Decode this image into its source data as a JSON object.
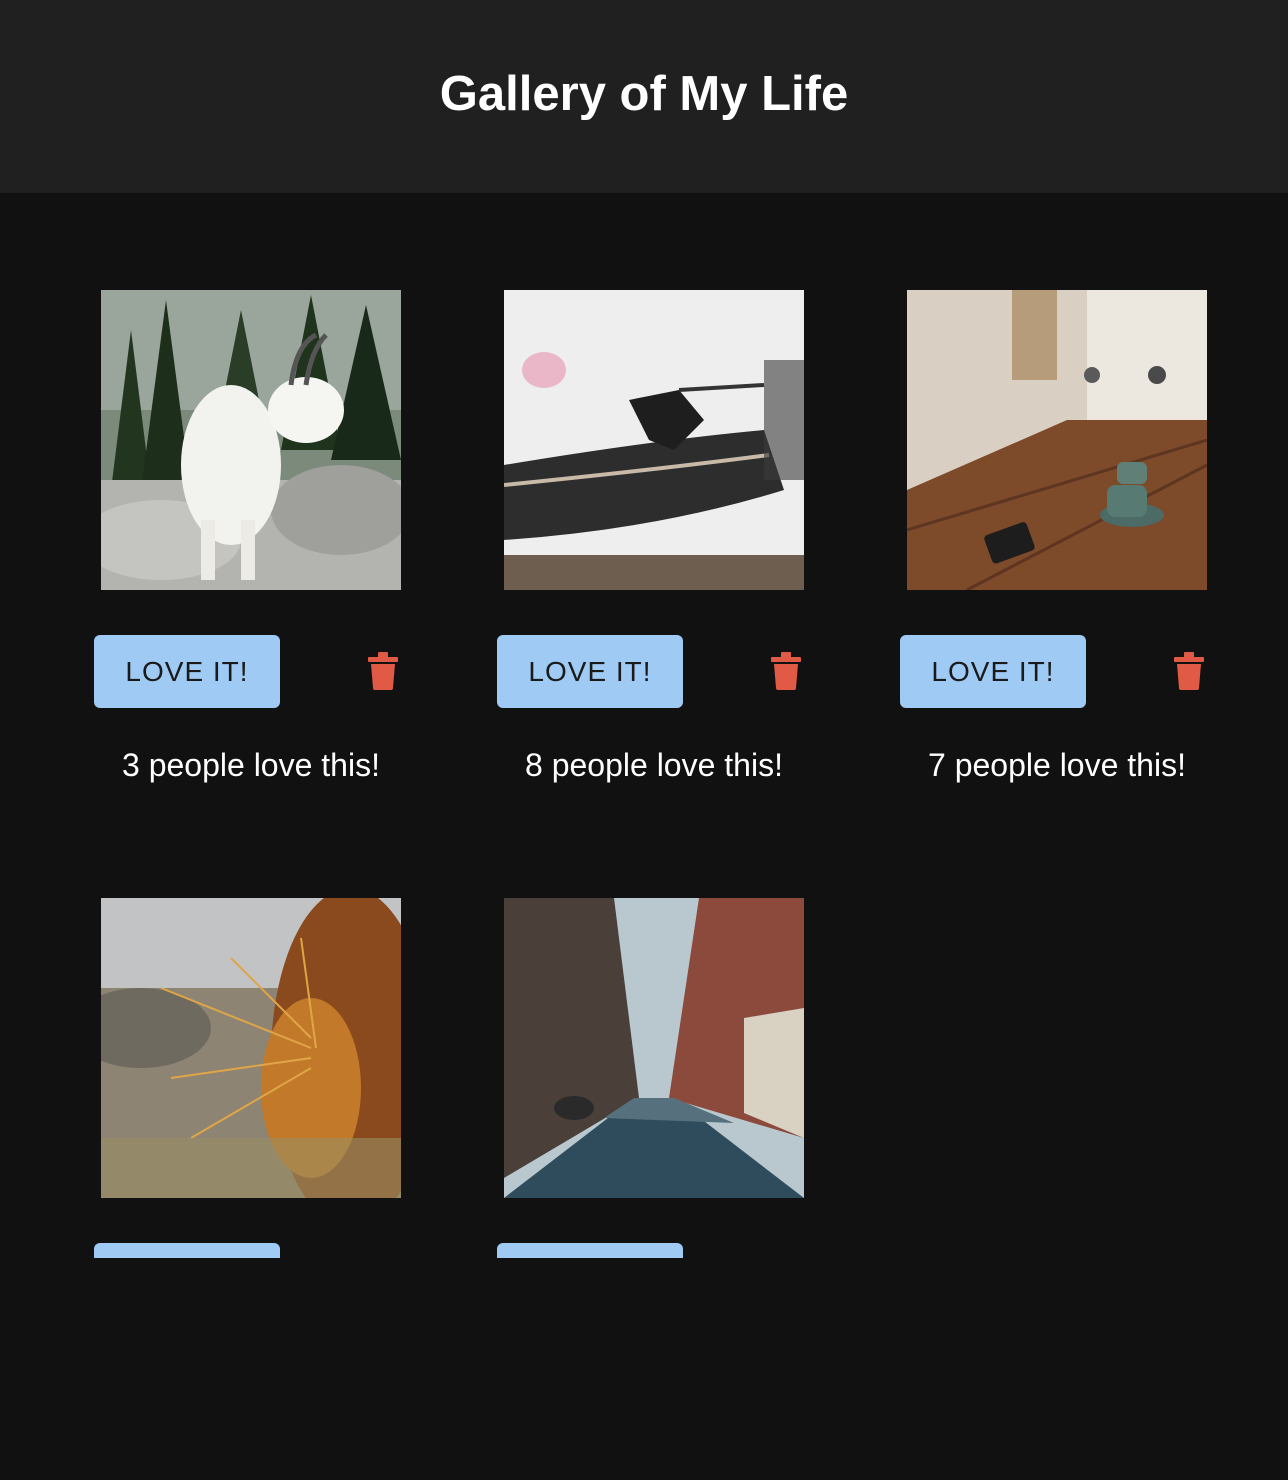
{
  "header": {
    "title": "Gallery of My Life"
  },
  "gallery": {
    "items": [
      {
        "image": "mountain-goat-photo",
        "button_label": "LOVE IT!",
        "likes_text": "3 people love this!",
        "delete_icon": "trash-icon"
      },
      {
        "image": "record-player-photo",
        "button_label": "LOVE IT!",
        "likes_text": "8 people love this!",
        "delete_icon": "trash-icon"
      },
      {
        "image": "cafe-table-coffee-photo",
        "button_label": "LOVE IT!",
        "likes_text": "7 people love this!",
        "delete_icon": "trash-icon"
      },
      {
        "image": "cactus-closeup-photo"
      },
      {
        "image": "city-street-photo"
      }
    ]
  },
  "colors": {
    "header_bg": "#202020",
    "page_bg": "#111111",
    "button_bg": "#9fcaf4",
    "delete_icon": "#e05a45"
  }
}
